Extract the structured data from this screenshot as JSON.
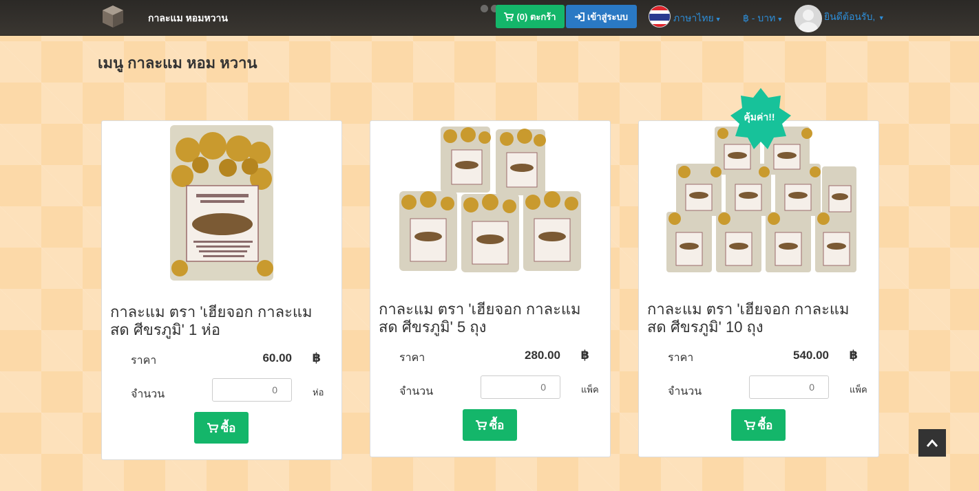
{
  "header": {
    "brand": "กาละแม หอมหวาน",
    "cart_label": "(0) ตะกร้า",
    "login_label": "เข้าสู่ระบบ",
    "language_label": "ภาษาไทย",
    "currency_label": "฿ - บาท",
    "welcome_label": "ยินดีต้อนรับ,"
  },
  "page": {
    "title": "เมนู กาละแม หอม หวาน"
  },
  "products": [
    {
      "name": "กาละแม ตรา 'เฮียจอก กาละแมสด ศีขรภูมิ' 1 ห่อ",
      "price_label": "ราคา",
      "price": "60.00",
      "currency": "฿",
      "qty_label": "จำนวน",
      "qty_placeholder": "0",
      "unit": "ห่อ",
      "buy_label": "ซื้อ"
    },
    {
      "name": "กาละแม ตรา 'เฮียจอก กาละแมสด ศีขรภูมิ' 5 ถุง",
      "price_label": "ราคา",
      "price": "280.00",
      "currency": "฿",
      "qty_label": "จำนวน",
      "qty_placeholder": "0",
      "unit": "แพ็ค",
      "buy_label": "ซื้อ"
    },
    {
      "name": "กาละแม ตรา 'เฮียจอก กาละแมสด ศีขรภูมิ' 10 ถุง",
      "price_label": "ราคา",
      "price": "540.00",
      "currency": "฿",
      "qty_label": "จำนวน",
      "qty_placeholder": "0",
      "unit": "แพ็ค",
      "buy_label": "ซื้อ"
    }
  ],
  "badge": {
    "label": "คุ้มค่า!!"
  },
  "colors": {
    "accent_green": "#14b66a",
    "login_blue": "#2a79c4",
    "link_blue": "#2d8ed9",
    "badge_teal": "#17c29a"
  },
  "icons": [
    "logo-icon",
    "cart-icon",
    "login-icon",
    "thai-flag-icon",
    "avatar-icon",
    "arrow-up-icon"
  ]
}
